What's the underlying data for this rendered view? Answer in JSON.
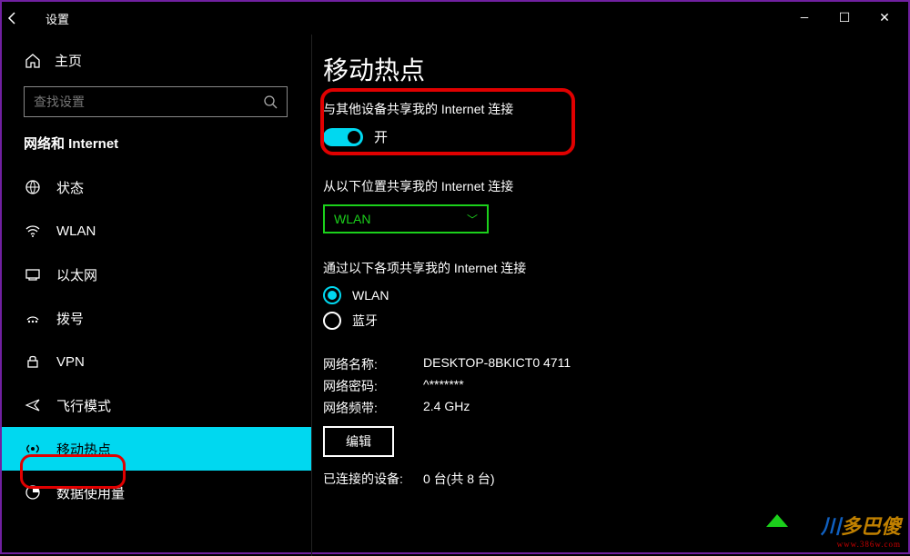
{
  "window": {
    "title": "设置",
    "controls": {
      "min": "—",
      "max": "☐",
      "close": "✕"
    }
  },
  "sidebar": {
    "home": "主页",
    "search_placeholder": "查找设置",
    "section": "网络和 Internet",
    "items": [
      {
        "label": "状态"
      },
      {
        "label": "WLAN"
      },
      {
        "label": "以太网"
      },
      {
        "label": "拨号"
      },
      {
        "label": "VPN"
      },
      {
        "label": "飞行模式"
      },
      {
        "label": "移动热点",
        "selected": true
      },
      {
        "label": "数据使用量"
      }
    ]
  },
  "main": {
    "title": "移动热点",
    "share": {
      "label": "与其他设备共享我的 Internet 连接",
      "state": "开"
    },
    "from": {
      "label": "从以下位置共享我的 Internet 连接",
      "value": "WLAN"
    },
    "via": {
      "label": "通过以下各项共享我的 Internet 连接",
      "options": [
        {
          "label": "WLAN",
          "selected": true
        },
        {
          "label": "蓝牙",
          "selected": false
        }
      ]
    },
    "info": {
      "name_label": "网络名称:",
      "name_value": "DESKTOP-8BKICT0 4711",
      "pwd_label": "网络密码:",
      "pwd_value": "^*******",
      "band_label": "网络频带:",
      "band_value": "2.4 GHz",
      "edit": "编辑"
    },
    "connected": {
      "label": "已连接的设备:",
      "value": "0 台(共 8 台)"
    }
  },
  "watermark": {
    "t1": "川",
    "t2": "多巴傻",
    "sub": "www.386w.com"
  }
}
